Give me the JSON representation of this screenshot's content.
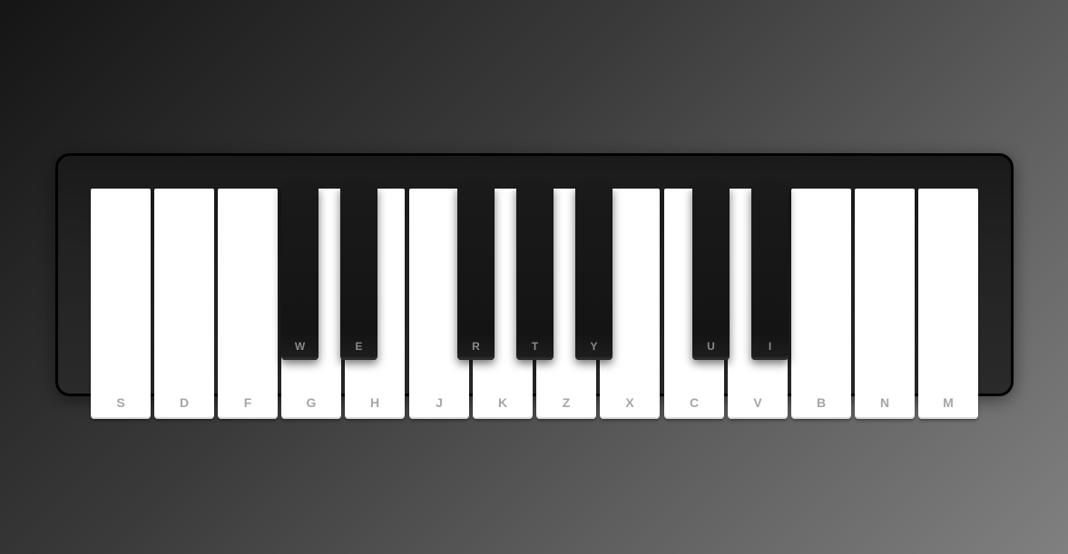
{
  "piano": {
    "white_keys": [
      "S",
      "D",
      "F",
      "G",
      "H",
      "J",
      "K",
      "Z",
      "X",
      "C",
      "V",
      "B",
      "N",
      "M"
    ],
    "black_keys": [
      "W",
      "E",
      "R",
      "T",
      "Y",
      "U",
      "I"
    ]
  }
}
